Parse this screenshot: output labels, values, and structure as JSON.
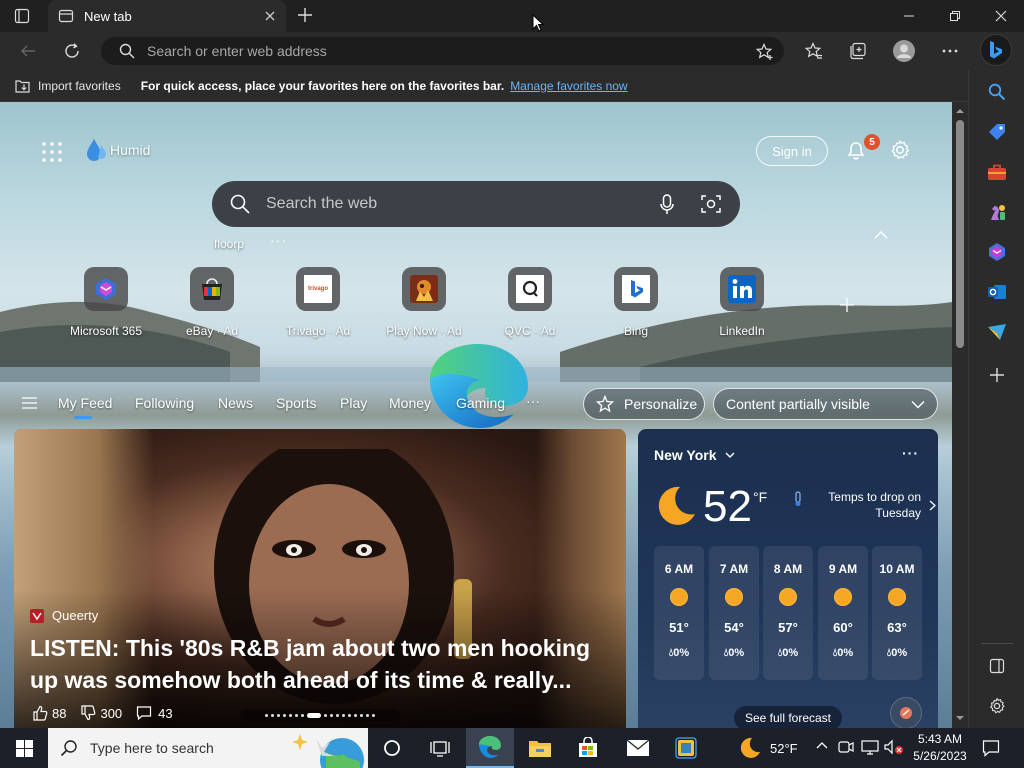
{
  "window": {
    "tab_title": "New tab",
    "new_tab_label": "+"
  },
  "toolbar": {
    "address_placeholder": "Search or enter web address"
  },
  "favorites_bar": {
    "import_label": "Import favorites",
    "message": "For quick access, place your favorites here on the favorites bar.",
    "manage_link": "Manage favorites now"
  },
  "ntp": {
    "brand": "Humid",
    "sign_in": "Sign in",
    "notification_count": "5",
    "search_placeholder": "Search the web",
    "suggestion": "floorp",
    "more": "···",
    "tiles": [
      {
        "label": "Microsoft 365",
        "ad": ""
      },
      {
        "label": "eBay",
        "ad": "· Ad"
      },
      {
        "label": "Trivago",
        "ad": "· Ad"
      },
      {
        "label": "Play Now",
        "ad": "· Ad"
      },
      {
        "label": "QVC",
        "ad": "· Ad"
      },
      {
        "label": "Bing",
        "ad": ""
      },
      {
        "label": "LinkedIn",
        "ad": ""
      }
    ],
    "trivago_text": "trivago",
    "feed_tabs": [
      "My Feed",
      "Following",
      "News",
      "Sports",
      "Play",
      "Money",
      "Gaming"
    ],
    "feed_more": "···",
    "personalize": "Personalize",
    "content_visibility": "Content partially visible"
  },
  "article": {
    "source": "Queerty",
    "headline": "LISTEN: This '80s R&B jam about two men hooking up was somehow both ahead of its time & really...",
    "likes": "88",
    "dislikes": "300",
    "comments": "43"
  },
  "weather": {
    "location": "New York",
    "temp": "52",
    "unit": "°F",
    "alert": "Temps to drop on Tuesday",
    "hours": [
      {
        "time": "6 AM",
        "temp": "51°",
        "precip": "0%"
      },
      {
        "time": "7 AM",
        "temp": "54°",
        "precip": "0%"
      },
      {
        "time": "8 AM",
        "temp": "57°",
        "precip": "0%"
      },
      {
        "time": "9 AM",
        "temp": "60°",
        "precip": "0%"
      },
      {
        "time": "10 AM",
        "temp": "63°",
        "precip": "0%"
      }
    ],
    "forecast_button": "See full forecast"
  },
  "taskbar": {
    "search_placeholder": "Type here to search",
    "weather_temp": "52°F",
    "time": "5:43 AM",
    "date": "5/26/2023"
  },
  "colors": {
    "accent_link": "#6cb4f5",
    "notification": "#e0512e",
    "sun": "#f5a623",
    "taskbar": "#1b2029"
  }
}
